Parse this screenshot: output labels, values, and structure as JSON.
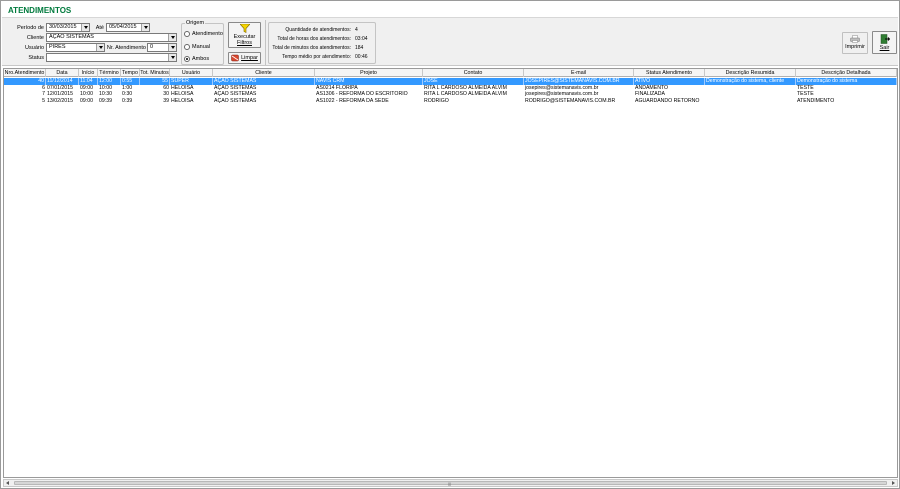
{
  "window": {
    "title": "ATENDIMENTOS"
  },
  "filters": {
    "periodo_label": "Período de",
    "periodo_de": "30/03/2015",
    "ate_label": "Até",
    "periodo_ate": "05/04/2015",
    "cliente_label": "Cliente",
    "cliente_value": "AÇÃO SISTEMAS",
    "usuario_label": "Usuário",
    "usuario_value": "PIRES",
    "nr_atendimento_label": "Nr. Atendimento",
    "nr_atendimento_value": "0",
    "status_label": "Status",
    "status_value": ""
  },
  "origem": {
    "legend": "Origem",
    "options": [
      {
        "label": "Atendimento",
        "checked": false
      },
      {
        "label": "Manual",
        "checked": false
      },
      {
        "label": "Ambos",
        "checked": true
      }
    ]
  },
  "buttons": {
    "executar_label": "Executar",
    "executar_label2": "Filtros",
    "limpar_label": "Limpar",
    "imprimir_label": "Imprimir",
    "sair_label": "Sair"
  },
  "stats": {
    "rows": [
      {
        "label": "Quantidade de atendimentos:",
        "value": "4"
      },
      {
        "label": "Total de horas dos atendimentos:",
        "value": "03:04"
      },
      {
        "label": "Total de minutos dos atendimentos:",
        "value": "184"
      },
      {
        "label": "Tempo médio por atendimento:",
        "value": "00:46"
      }
    ]
  },
  "grid": {
    "columns": [
      "Nro.Atendimento",
      "Data",
      "Início",
      "Término",
      "Tempo",
      "Tot. Minutos",
      "Usuário",
      "Cliente",
      "Projeto",
      "Contato",
      "E-mail",
      "Status Atendimento",
      "Descrição Resumida",
      "Descrição Detalhada"
    ],
    "rows": [
      [
        "40",
        "11/12/2014",
        "11:04",
        "12:00",
        "0:55",
        "55",
        "SUPER",
        "AÇÃO SISTEMAS",
        "NAVIS CRM",
        "JOSE",
        "JOSEPIRES@SISTEMANAVIS.COM.BR",
        "ATIVO",
        "Demonstração do sistema, cliente",
        "Demonstração do sistema"
      ],
      [
        "6",
        "07/01/2015",
        "09:00",
        "10:00",
        "1:00",
        "60",
        "HELOISA",
        "AÇÃO SISTEMAS",
        "AS0214 FLORIPA",
        "RITA L CARDOSO ALMEIDA ALVIM",
        "josepires@sistemanavis.com.br",
        "ANDAMENTO",
        "",
        "TESTE"
      ],
      [
        "7",
        "12/01/2015",
        "10:00",
        "10:30",
        "0:30",
        "30",
        "HELOISA",
        "AÇÃO SISTEMAS",
        "AS1306 - REFORMA DO ESCRITÓRIO",
        "RITA L CARDOSO ALMEIDA ALVIM",
        "josepires@sistemanavis.com.br",
        "FINALIZADA",
        "",
        "TESTE"
      ],
      [
        "5",
        "13/02/2015",
        "09:00",
        "09:39",
        "0:39",
        "39",
        "HELOISA",
        "AÇÃO SISTEMAS",
        "AS1022 - REFORMA DA SEDE",
        "RODRIGO",
        "RODRIGO@SISTEMANAVIS.COM.BR",
        "AGUARDANDO RETORNO",
        "",
        "ATENDIMENTO"
      ]
    ],
    "selected_row": 0
  },
  "colors": {
    "title": "#007a3d",
    "selection": "#3399ff"
  }
}
